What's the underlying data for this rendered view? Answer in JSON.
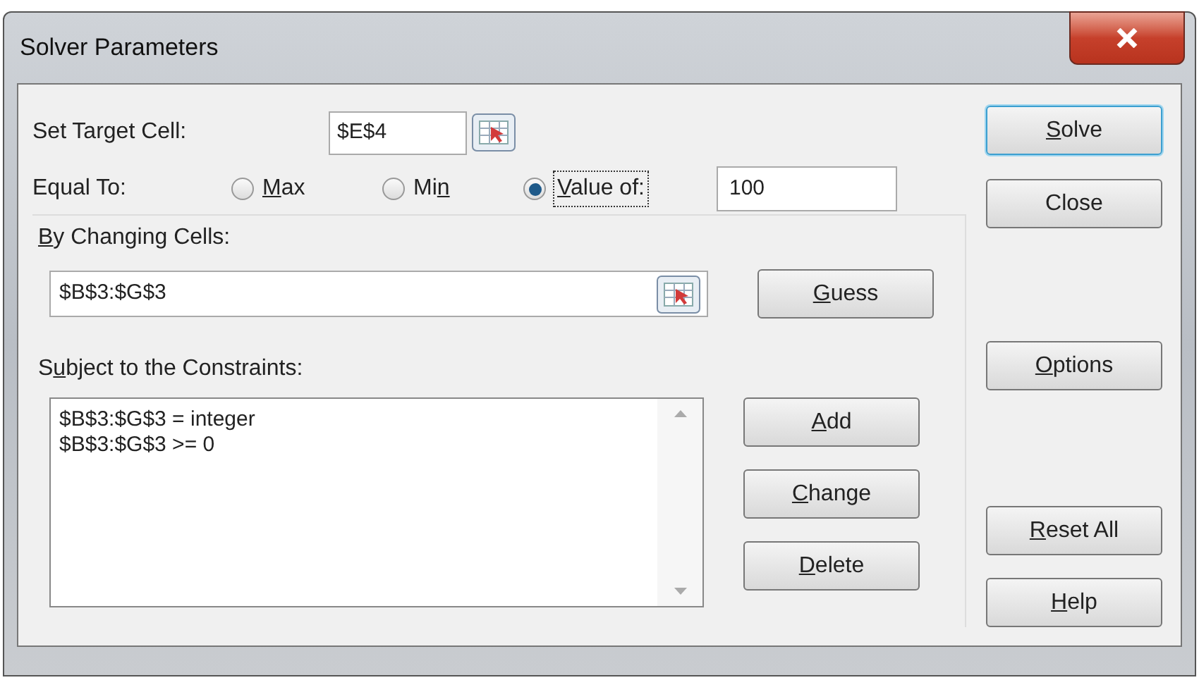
{
  "window": {
    "title": "Solver Parameters"
  },
  "target_cell": {
    "label": "Set Target Cell:",
    "value": "$E$4"
  },
  "equal_to": {
    "label": "Equal To:",
    "options": [
      {
        "label": {
          "key": "M",
          "post": "ax"
        },
        "selected": false
      },
      {
        "label": {
          "pre": "Mi",
          "key": "n"
        },
        "selected": false
      },
      {
        "label": {
          "key": "V",
          "post": "alue of:"
        },
        "selected": true
      }
    ],
    "value": "100"
  },
  "changing_cells": {
    "label": {
      "key": "B",
      "post": "y Changing Cells:"
    },
    "value": "$B$3:$G$3",
    "guess_button": {
      "key": "G",
      "post": "uess"
    }
  },
  "constraints": {
    "label": {
      "pre": "S",
      "key": "u",
      "post": "bject to the Constraints:"
    },
    "items": [
      "$B$3:$G$3 = integer",
      "$B$3:$G$3 >= 0"
    ],
    "buttons": [
      {
        "key": "A",
        "post": "dd"
      },
      {
        "key": "C",
        "post": "hange"
      },
      {
        "key": "D",
        "post": "elete"
      }
    ]
  },
  "side_buttons": [
    {
      "label": {
        "key": "S",
        "post": "olve"
      },
      "default": true
    },
    {
      "label": {
        "pre": "Close"
      },
      "default": false
    },
    {
      "label": {
        "key": "O",
        "post": "ptions"
      },
      "default": false
    },
    {
      "label": {
        "key": "R",
        "post": "eset All"
      },
      "default": false
    },
    {
      "label": {
        "key": "H",
        "post": "elp"
      },
      "default": false
    }
  ]
}
